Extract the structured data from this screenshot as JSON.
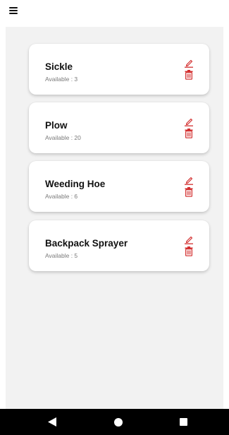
{
  "app_bar": {
    "menu_icon": "hamburger-menu-icon"
  },
  "tools": [
    {
      "name": "Sickle",
      "availability": "Available : 3"
    },
    {
      "name": "Plow",
      "availability": "Available : 20"
    },
    {
      "name": "Weeding Hoe",
      "availability": "Available : 6"
    },
    {
      "name": "Backpack Sprayer",
      "availability": "Available : 5"
    }
  ],
  "actions": {
    "edit_icon": "pencil-icon",
    "delete_icon": "trash-icon"
  },
  "system_nav": {
    "back_icon": "back-triangle-icon",
    "home_icon": "home-circle-icon",
    "recents_icon": "recents-square-icon"
  },
  "colors": {
    "accent_red": "#d32f2f",
    "content_background": "#f2f2f2",
    "card_background": "#ffffff",
    "nav_bar": "#000000"
  }
}
